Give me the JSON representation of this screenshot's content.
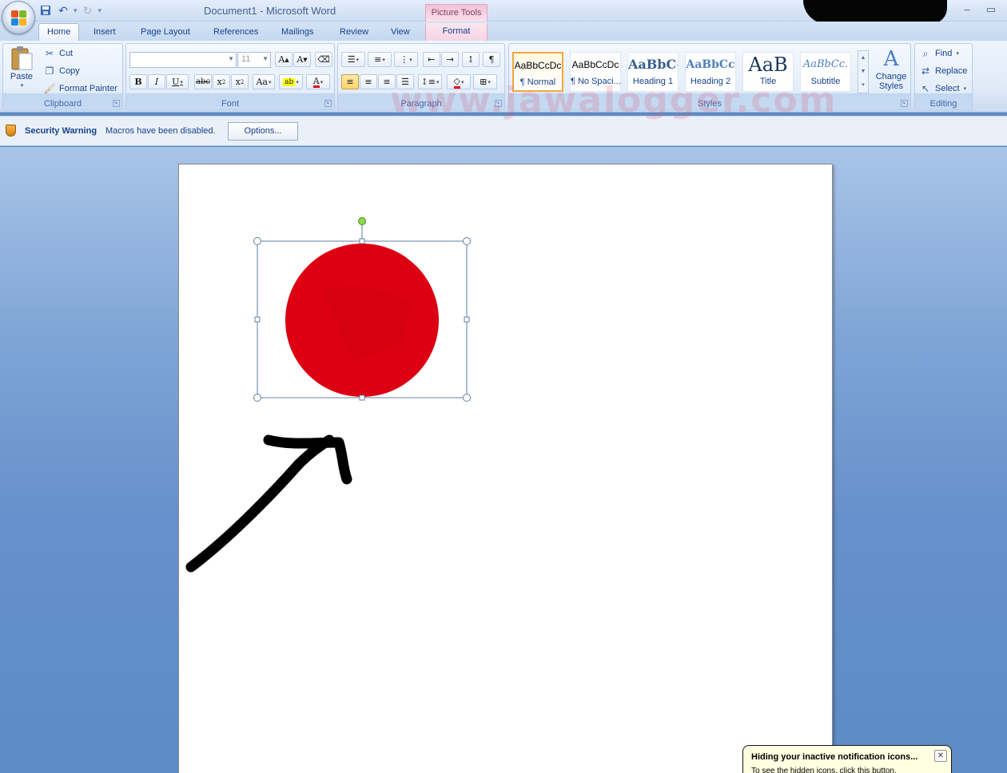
{
  "window": {
    "title": "Document1 - Microsoft Word",
    "context_header": "Picture Tools"
  },
  "tabs": [
    "Home",
    "Insert",
    "Page Layout",
    "References",
    "Mailings",
    "Review",
    "View",
    "Format"
  ],
  "clipboard": {
    "paste_label": "Paste",
    "cut_label": "Cut",
    "copy_label": "Copy",
    "format_painter_label": "Format Painter",
    "group_label": "Clipboard"
  },
  "font": {
    "font_name_value": "",
    "font_size_value": "11",
    "group_label": "Font"
  },
  "paragraph": {
    "group_label": "Paragraph"
  },
  "styles": {
    "group_label": "Styles",
    "items": [
      {
        "sample": "AaBbCcDc",
        "name": "¶ Normal"
      },
      {
        "sample": "AaBbCcDc",
        "name": "¶ No Spaci..."
      },
      {
        "sample": "AaBbC‹",
        "name": "Heading 1"
      },
      {
        "sample": "AaBbCc",
        "name": "Heading 2"
      },
      {
        "sample": "AaB",
        "name": "Title"
      },
      {
        "sample": "AaBbCc.",
        "name": "Subtitle"
      }
    ],
    "change_styles_label": "Change Styles"
  },
  "editing": {
    "group_label": "Editing",
    "find_label": "Find",
    "replace_label": "Replace",
    "select_label": "Select"
  },
  "security_bar": {
    "title": "Security Warning",
    "message": "Macros have been disabled.",
    "options_label": "Options..."
  },
  "watermark": "www.jawalogger.com",
  "notification": {
    "title": "Hiding your inactive notification icons...",
    "body": "To see the hidden icons, click this button."
  },
  "colors": {
    "circle_fill": "#dc0012",
    "ribbon_text": "#15428b",
    "context_tab": "#f4d4e3"
  }
}
